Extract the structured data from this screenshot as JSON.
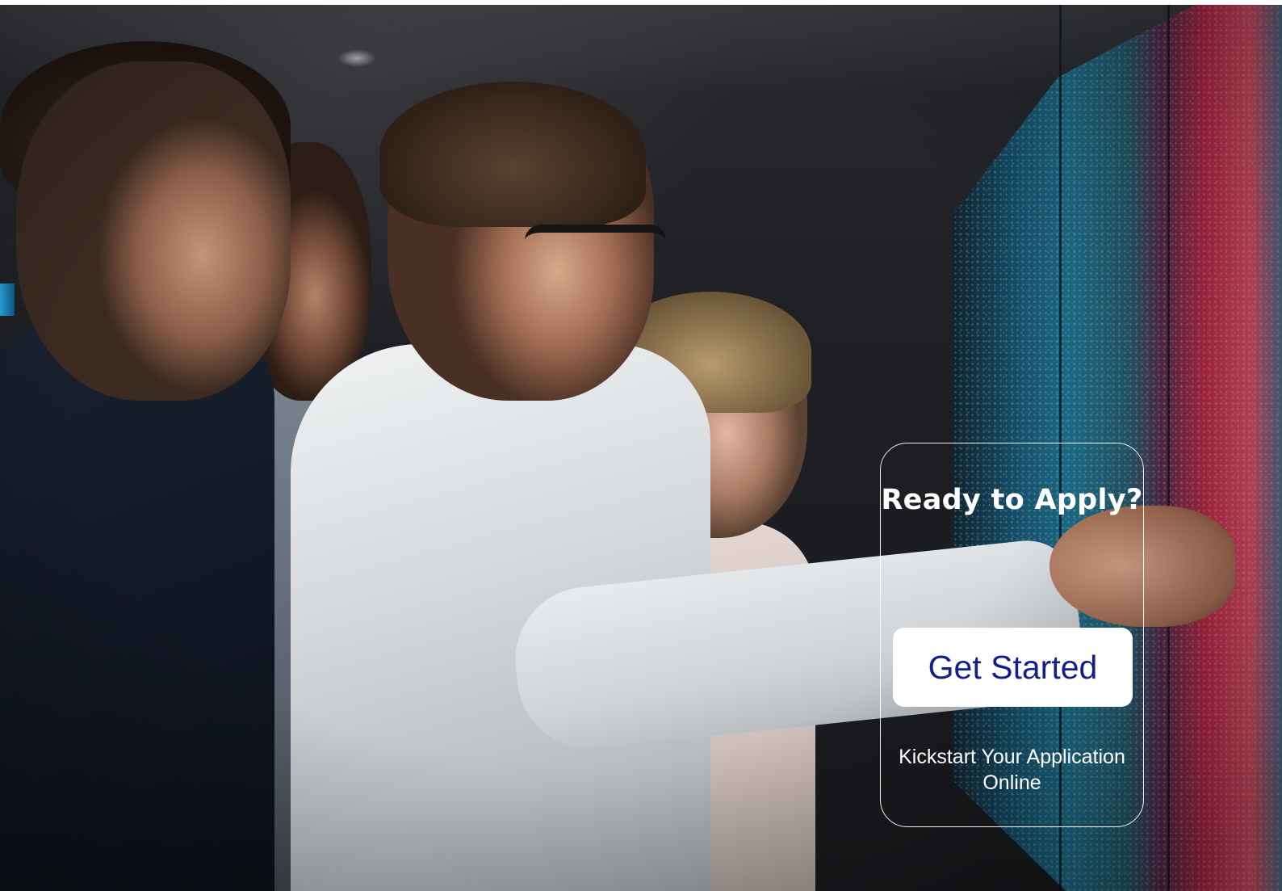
{
  "hero": {
    "image_alt": "Team of professionals looking at a large data visualization screen"
  },
  "cta": {
    "title": "Ready to Apply?",
    "button_label": "Get Started",
    "subtitle": "Kickstart Your Application Online"
  },
  "colors": {
    "button_background": "#ffffff",
    "button_text": "#0f1f8c",
    "card_border": "#ffffff",
    "text": "#ffffff"
  }
}
